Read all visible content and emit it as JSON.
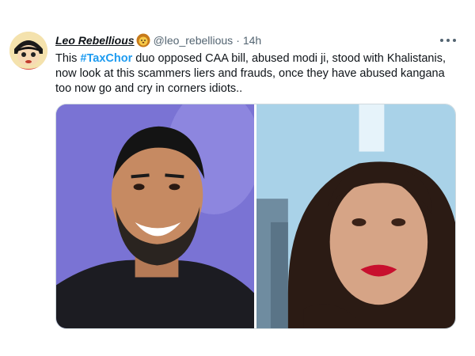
{
  "tweet": {
    "display_name": "Leo Rebellious",
    "handle": "@leo_rebellious",
    "separator": "·",
    "time": "14h",
    "text_prefix": "This ",
    "hashtag": "#TaxChor",
    "text_body": " duo opposed CAA bill, abused modi ji, stood with Khalistanis, now look at this scammers liers and frauds, once they have abused kangana too now go and cry in corners idiots.."
  },
  "icons": {
    "avatar": "cartoon-avatar",
    "name_emoji": "lion-face-icon",
    "more": "more-horizontal-icon"
  },
  "colors": {
    "hashtag": "#1d9bf0",
    "secondary_text": "#536471",
    "primary_text": "#0f1419",
    "media_border": "#cfd9de"
  },
  "media": {
    "count": 2
  }
}
